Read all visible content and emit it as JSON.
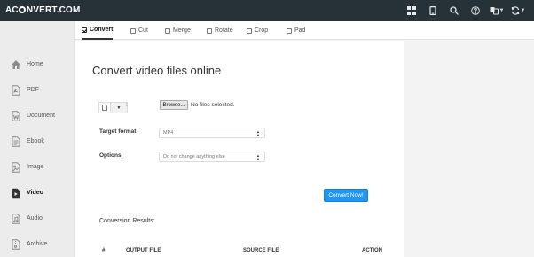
{
  "header": {
    "logo_text_left": "AC",
    "logo_text_right": "NVERT.COM",
    "icons": [
      "grid-icon",
      "tablet-icon",
      "search-icon",
      "help-icon",
      "language-icon",
      "refresh-icon"
    ]
  },
  "sidebar": {
    "items": [
      {
        "label": "Home",
        "icon": "home-icon"
      },
      {
        "label": "PDF",
        "icon": "pdf-icon"
      },
      {
        "label": "Document",
        "icon": "document-icon"
      },
      {
        "label": "Ebook",
        "icon": "ebook-icon"
      },
      {
        "label": "Image",
        "icon": "image-icon"
      },
      {
        "label": "Video",
        "icon": "video-icon",
        "active": true
      },
      {
        "label": "Audio",
        "icon": "audio-icon"
      },
      {
        "label": "Archive",
        "icon": "archive-icon"
      }
    ]
  },
  "tabs": [
    {
      "label": "Convert",
      "active": true
    },
    {
      "label": "Cut"
    },
    {
      "label": "Merge"
    },
    {
      "label": "Rotate"
    },
    {
      "label": "Crop"
    },
    {
      "label": "Pad"
    }
  ],
  "main": {
    "title": "Convert video files online",
    "file_source_colon": ":",
    "browse_label": "Browse...",
    "no_file_text": "No files selected.",
    "target_format_label": "Target format:",
    "target_format_value": "MP4",
    "options_label": "Options:",
    "options_value": "Do not change anything else",
    "convert_button": "Convert Now!",
    "results_label": "Conversion Results:",
    "results_columns": [
      "#",
      "OUTPUT FILE",
      "SOURCE FILE",
      "ACTION"
    ]
  },
  "colors": {
    "topbar": "#263238",
    "accent": "#2196f3"
  }
}
